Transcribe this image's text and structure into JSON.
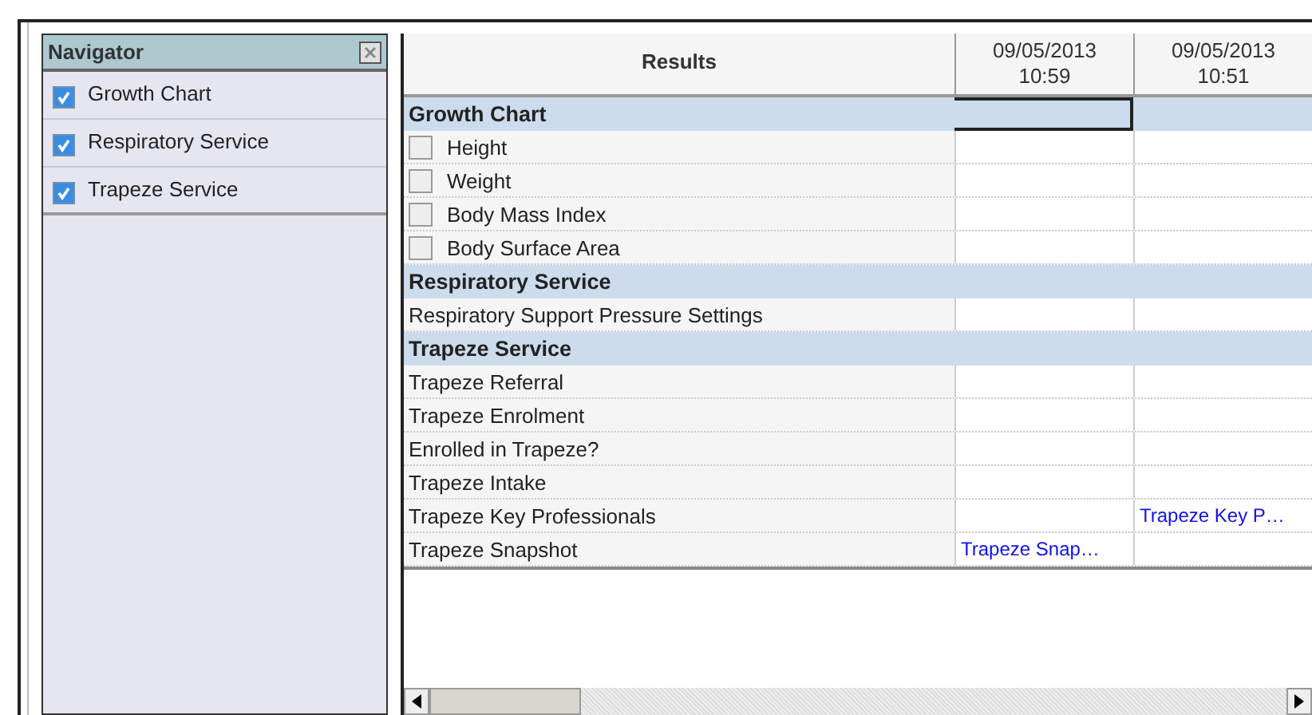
{
  "navigator": {
    "title": "Navigator",
    "items": [
      {
        "label": "Growth Chart",
        "checked": true
      },
      {
        "label": "Respiratory Service",
        "checked": true
      },
      {
        "label": "Trapeze Service",
        "checked": true
      }
    ]
  },
  "results": {
    "label_header": "Results",
    "columns": [
      "09/05/2013\n10:59",
      "09/05/2013\n10:51"
    ],
    "rows": [
      {
        "kind": "group",
        "label": "Growth Chart",
        "cells": [
          {
            "focused": true
          },
          {
            "focused": false
          }
        ]
      },
      {
        "kind": "check",
        "label": "Height",
        "checked": false,
        "cells": [
          {
            "focused": false
          },
          {
            "focused": false
          }
        ]
      },
      {
        "kind": "check",
        "label": "Weight",
        "checked": false,
        "cells": [
          {
            "focused": false
          },
          {
            "focused": false
          }
        ]
      },
      {
        "kind": "check",
        "label": "Body Mass Index",
        "checked": false,
        "cells": [
          {
            "focused": false
          },
          {
            "focused": false
          }
        ]
      },
      {
        "kind": "check",
        "label": "Body Surface Area",
        "checked": false,
        "cells": [
          {
            "focused": false
          },
          {
            "focused": false
          }
        ]
      },
      {
        "kind": "group",
        "label": "Respiratory Service",
        "cells": [
          {
            "focused": false
          },
          {
            "focused": false
          }
        ]
      },
      {
        "kind": "plain",
        "label": "Respiratory Support Pressure Settings",
        "cells": [
          {
            "focused": false
          },
          {
            "focused": false
          }
        ]
      },
      {
        "kind": "group",
        "label": "Trapeze Service",
        "cells": [
          {
            "focused": false
          },
          {
            "focused": false
          }
        ]
      },
      {
        "kind": "plain",
        "label": "Trapeze Referral",
        "cells": [
          {
            "focused": false
          },
          {
            "focused": false
          }
        ]
      },
      {
        "kind": "plain",
        "label": "Trapeze Enrolment",
        "cells": [
          {
            "focused": false
          },
          {
            "focused": false
          }
        ]
      },
      {
        "kind": "plain",
        "label": "Enrolled in Trapeze?",
        "cells": [
          {
            "focused": false
          },
          {
            "focused": false
          }
        ]
      },
      {
        "kind": "plain",
        "label": "Trapeze Intake",
        "cells": [
          {
            "focused": false
          },
          {
            "focused": false
          }
        ]
      },
      {
        "kind": "plain",
        "label": "Trapeze Key Professionals",
        "cells": [
          {
            "focused": false
          },
          {
            "focused": false,
            "text": "Trapeze Key P…"
          }
        ]
      },
      {
        "kind": "plain",
        "label": "Trapeze Snapshot",
        "cells": [
          {
            "focused": false,
            "text": "Trapeze Snap…"
          },
          {
            "focused": false
          }
        ]
      }
    ]
  }
}
